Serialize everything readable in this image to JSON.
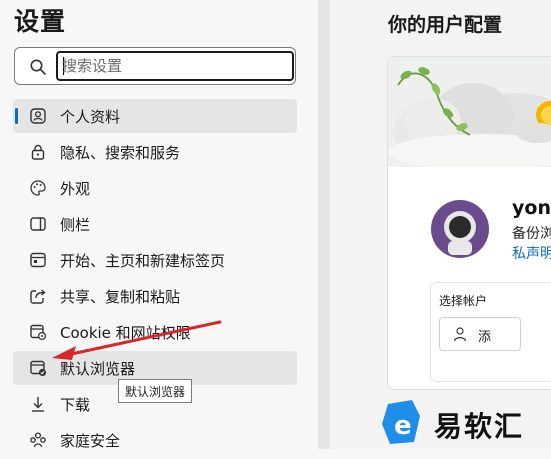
{
  "sidebar": {
    "title": "设置",
    "search": {
      "placeholder": "搜索设置",
      "value": ""
    },
    "items": [
      {
        "label": "个人资料",
        "icon": "profile-icon",
        "selected": true
      },
      {
        "label": "隐私、搜索和服务",
        "icon": "lock-icon"
      },
      {
        "label": "外观",
        "icon": "palette-icon"
      },
      {
        "label": "侧栏",
        "icon": "sidebar-icon"
      },
      {
        "label": "开始、主页和新建标签页",
        "icon": "home-icon"
      },
      {
        "label": "共享、复制和粘贴",
        "icon": "share-icon"
      },
      {
        "label": "Cookie 和网站权限",
        "icon": "site-permissions-icon"
      },
      {
        "label": "默认浏览器",
        "icon": "default-browser-icon",
        "hover": true
      },
      {
        "label": "下载",
        "icon": "download-icon"
      },
      {
        "label": "家庭安全",
        "icon": "family-icon"
      }
    ],
    "tooltip": "默认浏览器"
  },
  "main": {
    "title": "你的用户配置",
    "profile": {
      "name": "yong",
      "backup": "备份浏",
      "privacy": "私声明"
    },
    "account": {
      "label": "选择帐户",
      "add_button": "添"
    }
  },
  "watermark": {
    "text": "易软汇"
  },
  "colors": {
    "accent": "#0f6cbd",
    "arrow": "#d9262b",
    "watermark_blue": "#1e8ee8"
  }
}
